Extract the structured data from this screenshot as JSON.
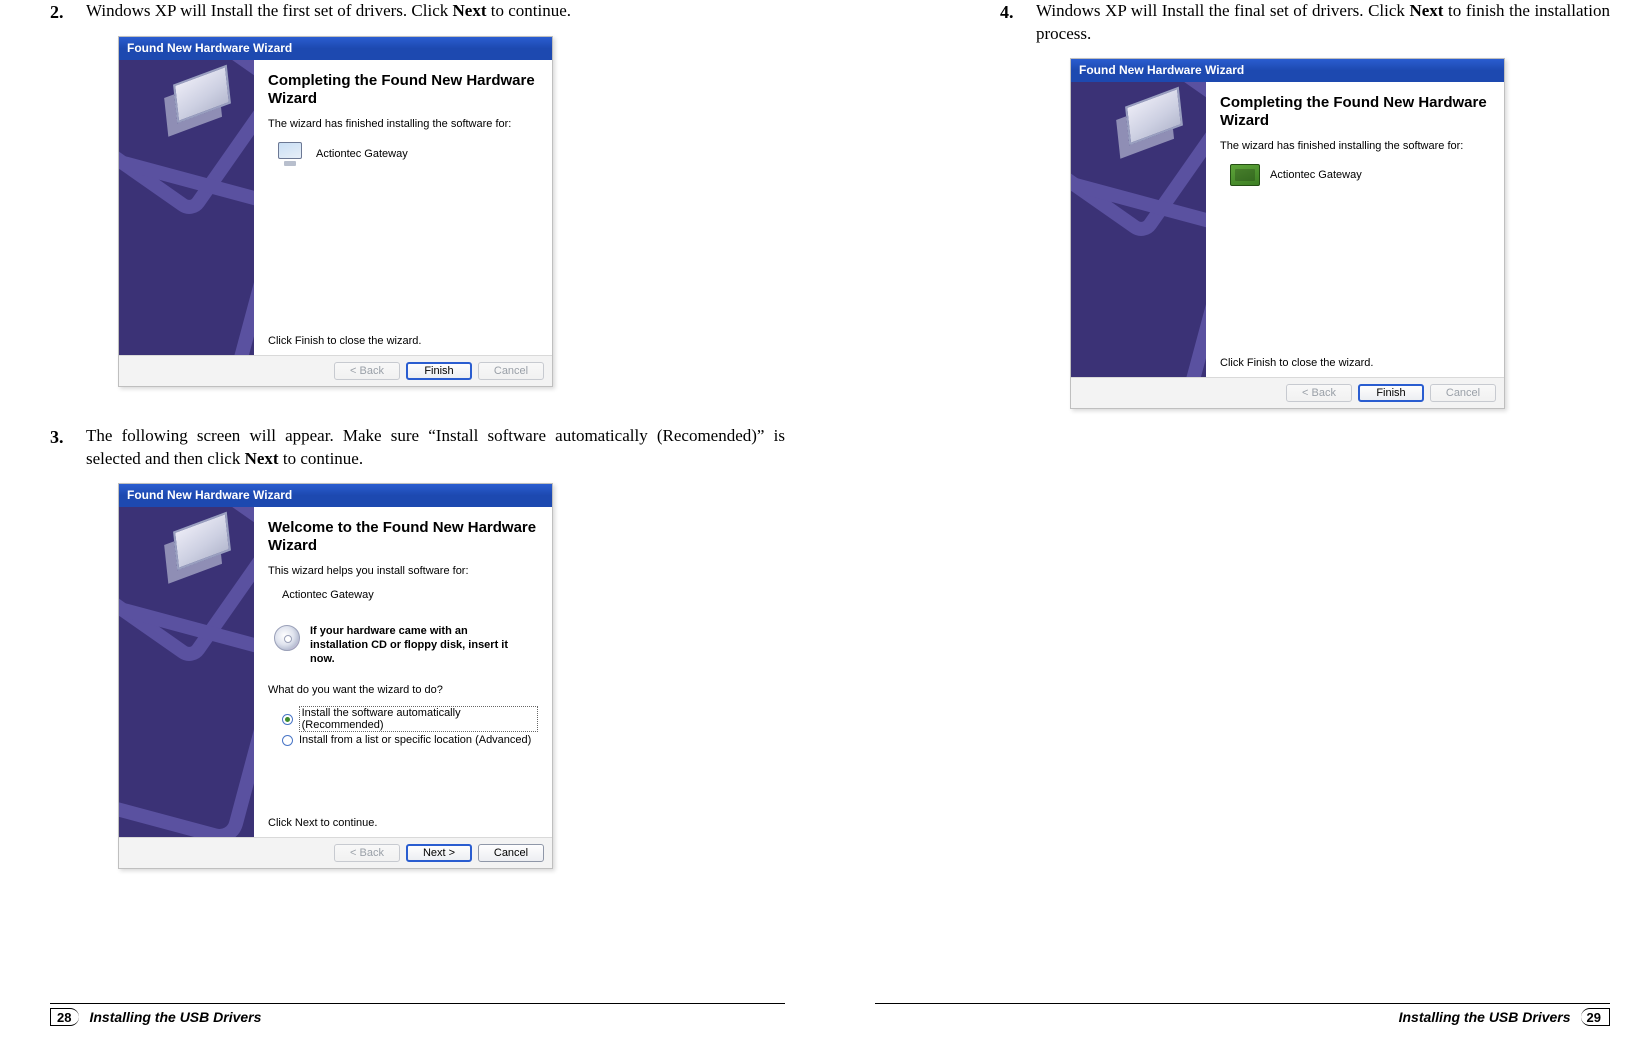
{
  "left": {
    "step2": {
      "num": "2.",
      "pre": "Windows XP will Install the first set of drivers. Click ",
      "bold": "Next",
      "post": " to continue."
    },
    "step3": {
      "num": "3.",
      "pre": "The following screen will appear. Make sure “Install software automatically (Recomended)” is selected and then click ",
      "bold": "Next",
      "post": " to continue."
    },
    "foot": {
      "num": "28",
      "title": "Installing the USB Drivers"
    }
  },
  "right": {
    "step4": {
      "num": "4.",
      "pre": "Windows XP will Install the final set of drivers. Click ",
      "bold": "Next",
      "post": " to finish the installation process."
    },
    "foot": {
      "num": "29",
      "title": "Installing the USB Drivers"
    }
  },
  "wizard": {
    "title": "Found New Hardware Wizard",
    "complete_heading": "Completing the Found New Hardware Wizard",
    "welcome_heading": "Welcome to the Found New Hardware Wizard",
    "finished_sub": "The wizard has finished installing the software for:",
    "helps_sub": "This wizard helps you install software for:",
    "device": "Actiontec Gateway",
    "cd_text": "If your hardware came with an installation CD or floppy disk, insert it now.",
    "prompt": "What do you want the wizard to do?",
    "radio1": "Install the software automatically (Recommended)",
    "radio2": "Install from a list or specific location (Advanced)",
    "click_next": "Click Next to continue.",
    "click_finish": "Click Finish to close the wizard.",
    "btn_back": "< Back",
    "btn_finish": "Finish",
    "btn_next": "Next >",
    "btn_cancel": "Cancel"
  }
}
